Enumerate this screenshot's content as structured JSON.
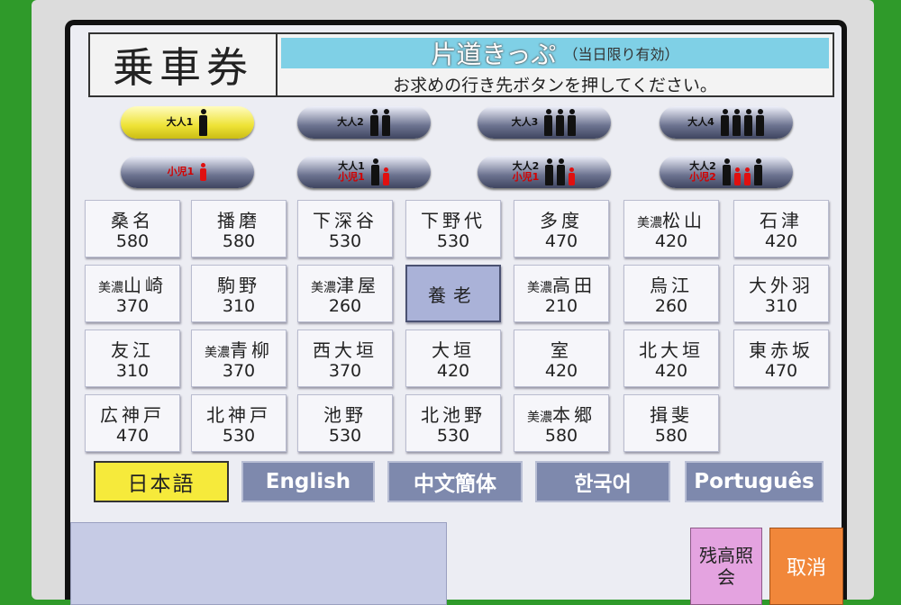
{
  "header": {
    "title": "乗車券",
    "ticket_type": "片道きっぷ",
    "validity": "（当日限り有効）",
    "instruction": "お求めの行き先ボタンを押してください。"
  },
  "passengers": [
    {
      "adult": "大人1",
      "child": ""
    },
    {
      "adult": "大人2",
      "child": ""
    },
    {
      "adult": "大人3",
      "child": ""
    },
    {
      "adult": "大人4",
      "child": ""
    },
    {
      "adult": "",
      "child": "小児1"
    },
    {
      "adult": "大人1",
      "child": "小児1"
    },
    {
      "adult": "大人2",
      "child": "小児1"
    },
    {
      "adult": "大人2",
      "child": "小児2"
    }
  ],
  "destinations": [
    {
      "prefix": "",
      "name": "桑名",
      "fare": "580"
    },
    {
      "prefix": "",
      "name": "播磨",
      "fare": "580"
    },
    {
      "prefix": "",
      "name": "下深谷",
      "fare": "530"
    },
    {
      "prefix": "",
      "name": "下野代",
      "fare": "530"
    },
    {
      "prefix": "",
      "name": "多度",
      "fare": "470"
    },
    {
      "prefix": "美濃",
      "name": "松山",
      "fare": "420"
    },
    {
      "prefix": "",
      "name": "石津",
      "fare": "420"
    },
    {
      "prefix": "美濃",
      "name": "山崎",
      "fare": "370"
    },
    {
      "prefix": "",
      "name": "駒野",
      "fare": "310"
    },
    {
      "prefix": "美濃",
      "name": "津屋",
      "fare": "260"
    },
    {
      "prefix": "",
      "name": "養老",
      "fare": ""
    },
    {
      "prefix": "美濃",
      "name": "高田",
      "fare": "210"
    },
    {
      "prefix": "",
      "name": "烏江",
      "fare": "260"
    },
    {
      "prefix": "",
      "name": "大外羽",
      "fare": "310"
    },
    {
      "prefix": "",
      "name": "友江",
      "fare": "310"
    },
    {
      "prefix": "美濃",
      "name": "青柳",
      "fare": "370"
    },
    {
      "prefix": "",
      "name": "西大垣",
      "fare": "370"
    },
    {
      "prefix": "",
      "name": "大垣",
      "fare": "420"
    },
    {
      "prefix": "",
      "name": "室",
      "fare": "420"
    },
    {
      "prefix": "",
      "name": "北大垣",
      "fare": "420"
    },
    {
      "prefix": "",
      "name": "東赤坂",
      "fare": "470"
    },
    {
      "prefix": "",
      "name": "広神戸",
      "fare": "470"
    },
    {
      "prefix": "",
      "name": "北神戸",
      "fare": "530"
    },
    {
      "prefix": "",
      "name": "池野",
      "fare": "530"
    },
    {
      "prefix": "",
      "name": "北池野",
      "fare": "530"
    },
    {
      "prefix": "美濃",
      "name": "本郷",
      "fare": "580"
    },
    {
      "prefix": "",
      "name": "揖斐",
      "fare": "580"
    }
  ],
  "languages": [
    "日本語",
    "English",
    "中文簡体",
    "한국어",
    "Português"
  ],
  "buttons": {
    "balance": "残高照会",
    "cancel": "取消"
  },
  "colors": {
    "selected_passenger": "#eee336",
    "selected_language": "#f6ea3b",
    "cancel": "#f1873a",
    "balance": "#e4a3e0"
  }
}
